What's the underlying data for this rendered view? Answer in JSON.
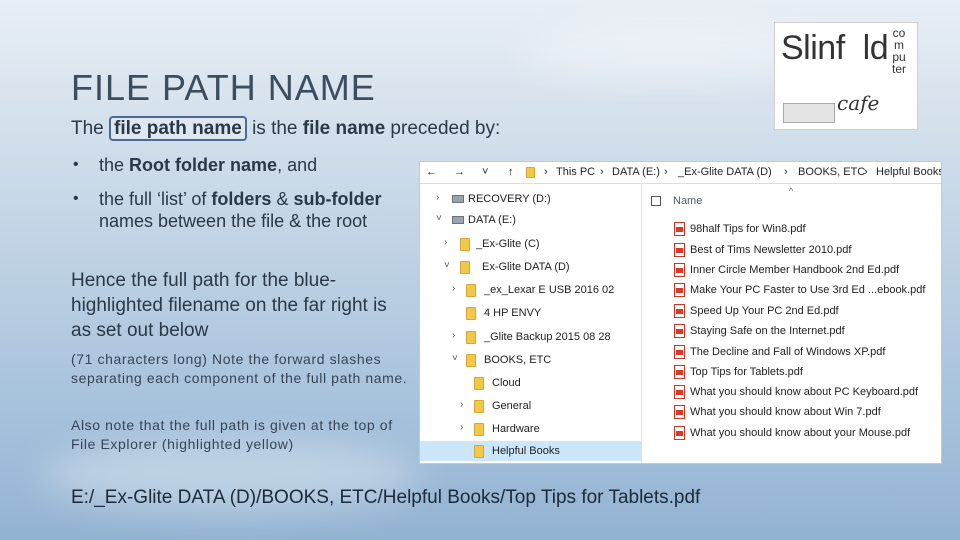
{
  "slide": {
    "title": "FILE PATH NAME",
    "intro": {
      "pre": "The",
      "highlight": "file path name",
      "mid": "is the",
      "bold": "file name",
      "post": "preceded by:"
    },
    "bullets": [
      {
        "pre": "the",
        "bold": "Root folder name",
        "post": ", and"
      },
      {
        "pre": "the full ‘list’ of",
        "bold1": "folders",
        "mid": "&",
        "bold2": "sub-folder",
        "post": "names between the file & the root"
      }
    ],
    "hence": "Hence the full path for the blue-highlighted filename on the far right is as set out below",
    "note1": "(71 characters long) Note the forward slashes separating each component of the full path name.",
    "note2": "Also note that the full path is given at the top of File Explorer (highlighted yellow)",
    "full_path": "E:/_Ex-Glite DATA (D)/BOOKS, ETC/Helpful Books/Top Tips for Tablets.pdf"
  },
  "logo": {
    "main": "Slinf",
    "main2": "ld",
    "vertical": "computer",
    "cafe": "cafe"
  },
  "explorer": {
    "nav_buttons": [
      "←",
      "→",
      "˅",
      "↑"
    ],
    "breadcrumb": [
      "This PC",
      "DATA (E:)",
      "_Ex-Glite DATA (D)",
      "BOOKS, ETC",
      "Helpful Books"
    ],
    "breadcrumb_sep": "›",
    "column_header": "Name",
    "sort_indicator": "^",
    "tree": [
      {
        "label": "RECOVERY (D:)",
        "kind": "drive",
        "chev": "›"
      },
      {
        "label": "DATA (E:)",
        "kind": "drive",
        "chev": "˅"
      },
      {
        "label": "_Ex-Glite (C)",
        "kind": "folder",
        "chev": "›"
      },
      {
        "label": "Ex-Glite DATA (D)",
        "kind": "folder",
        "chev": "˅"
      },
      {
        "label": "_ex_Lexar E USB 2016 02",
        "kind": "folder",
        "chev": "›"
      },
      {
        "label": "4 HP ENVY",
        "kind": "folder",
        "chev": ""
      },
      {
        "label": "_Glite Backup 2015 08 28",
        "kind": "folder",
        "chev": "›"
      },
      {
        "label": "BOOKS, ETC",
        "kind": "folder",
        "chev": "˅"
      },
      {
        "label": "Cloud",
        "kind": "folder",
        "chev": ""
      },
      {
        "label": "General",
        "kind": "folder",
        "chev": "›"
      },
      {
        "label": "Hardware",
        "kind": "folder",
        "chev": "›"
      },
      {
        "label": "Helpful Books",
        "kind": "folder",
        "chev": "",
        "selected": true
      }
    ],
    "files": [
      "98half Tips for Win8.pdf",
      "Best of Tims Newsletter 2010.pdf",
      "Inner Circle Member Handbook 2nd Ed.pdf",
      "Make Your PC Faster to Use 3rd Ed ...ebook.pdf",
      "Speed Up Your PC 2nd Ed.pdf",
      "Staying Safe on the Internet.pdf",
      "The Decline and Fall of Windows XP.pdf",
      "Top Tips for Tablets.pdf",
      "What you should know about PC Keyboard.pdf",
      "What you should know about Win 7.pdf",
      "What you should know about your Mouse.pdf"
    ]
  }
}
